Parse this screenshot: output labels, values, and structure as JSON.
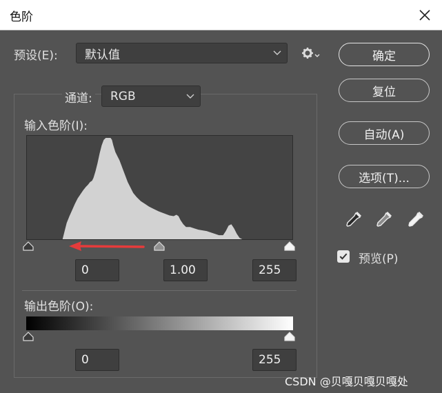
{
  "window": {
    "title": "色阶"
  },
  "preset": {
    "label": "预设(E):",
    "value": "默认值"
  },
  "channel": {
    "label": "通道:",
    "value": "RGB"
  },
  "input_levels": {
    "label": "输入色阶(I):",
    "black": "0",
    "gamma": "1.00",
    "white": "255"
  },
  "output_levels": {
    "label": "输出色阶(O):",
    "black": "0",
    "white": "255"
  },
  "buttons": {
    "ok": "确定",
    "reset": "复位",
    "auto": "自动(A)",
    "options": "选项(T)..."
  },
  "preview": {
    "label": "预览(P)",
    "checked": true
  },
  "watermark": "CSDN @贝嘎贝嘎贝嘎处",
  "colors": {
    "arrow": "#e63b3b",
    "histogram": "#d2d2d2"
  }
}
